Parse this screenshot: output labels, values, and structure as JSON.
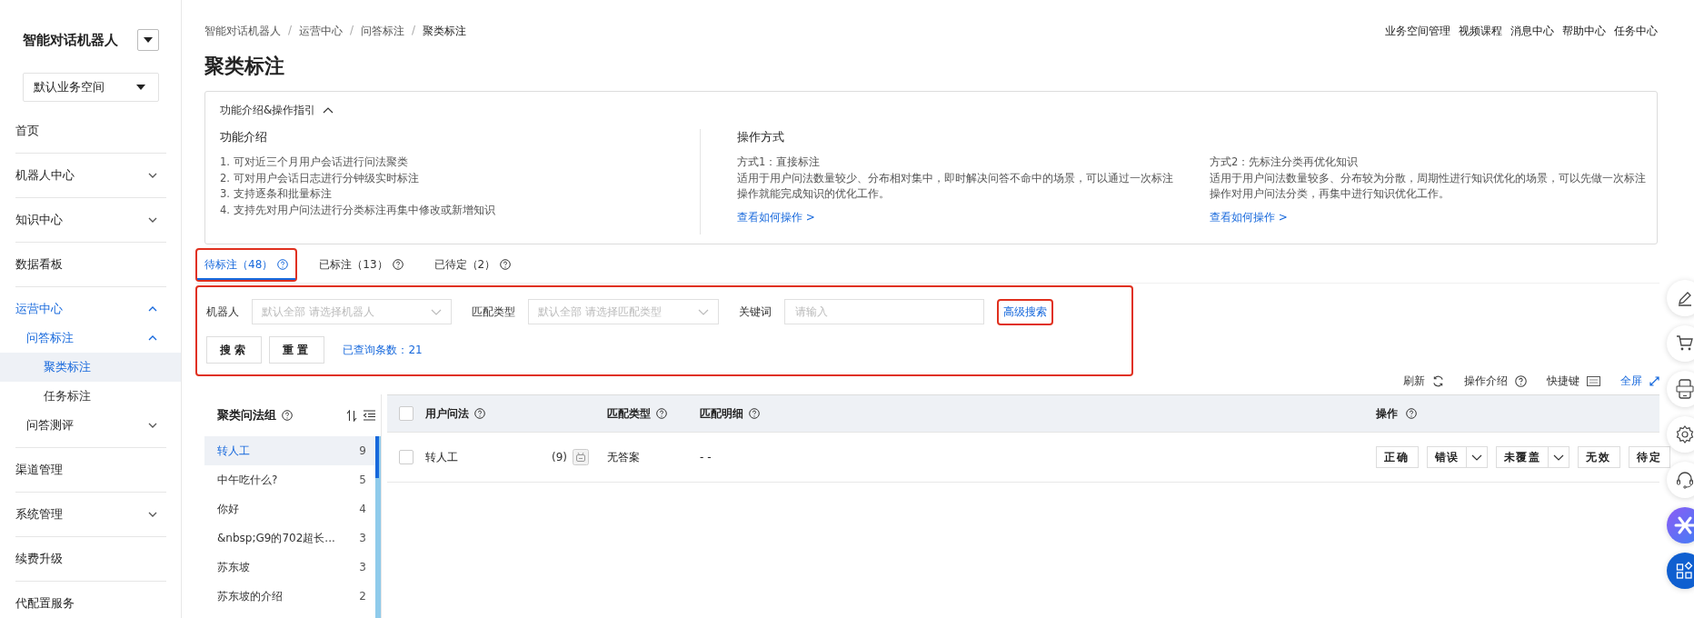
{
  "sidebar": {
    "app_name": "智能对话机器人",
    "workspace": "默认业务空间",
    "items": [
      {
        "label": "首页",
        "selected": false
      },
      {
        "label": "机器人中心",
        "selected": false,
        "expanded": false
      },
      {
        "label": "知识中心",
        "selected": false,
        "expanded": false
      },
      {
        "label": "数据看板",
        "selected": false
      },
      {
        "label": "运营中心",
        "selected": false,
        "expanded": true,
        "children": [
          {
            "label": "问答标注",
            "selected": false,
            "expanded": true,
            "children": [
              {
                "label": "聚类标注",
                "selected": true
              },
              {
                "label": "任务标注",
                "selected": false
              }
            ]
          },
          {
            "label": "问答测评",
            "selected": false,
            "expanded": false
          }
        ]
      },
      {
        "label": "渠道管理",
        "selected": false
      },
      {
        "label": "系统管理",
        "selected": false,
        "expanded": false
      },
      {
        "label": "续费升级",
        "selected": false
      },
      {
        "label": "代配置服务",
        "selected": false
      }
    ]
  },
  "breadcrumb": [
    "智能对话机器人",
    "运营中心",
    "问答标注",
    "聚类标注"
  ],
  "breadcrumb_separator": "/",
  "top_links": [
    "业务空间管理",
    "视频课程",
    "消息中心",
    "帮助中心",
    "任务中心"
  ],
  "page_title": "聚类标注",
  "intro": {
    "title": "功能介绍&操作指引",
    "expanded": true,
    "features_title": "功能介绍",
    "features": [
      "1. 可对近三个月用户会话进行问法聚类",
      "2. 可对用户会话日志进行分钟级实时标注",
      "3. 支持逐条和批量标注",
      "4. 支持先对用户问法进行分类标注再集中修改或新增知识"
    ],
    "methods_title": "操作方式",
    "methods": [
      {
        "name": "方式1：直接标注",
        "text": "适用于用户问法数量较少、分布相对集中，即时解决问答不命中的场景，可以通过一次标注操作就能完成知识的优化工作。",
        "link": "查看如何操作 >"
      },
      {
        "name": "方式2：先标注分类再优化知识",
        "text": "适用于用户问法数量较多、分布较为分散，周期性进行知识优化的场景，可以先做一次标注操作对用户问法分类，再集中进行知识优化工作。",
        "link": "查看如何操作 >"
      }
    ]
  },
  "tabs": [
    {
      "label": "待标注（48）",
      "selected": true,
      "highlighted": true
    },
    {
      "label": "已标注（13）",
      "selected": false,
      "highlighted": false
    },
    {
      "label": "已待定（2）",
      "selected": false,
      "highlighted": false
    }
  ],
  "filters": {
    "highlighted": true,
    "robot": {
      "label": "机器人",
      "placeholder": "默认全部 请选择机器人"
    },
    "match_type": {
      "label": "匹配类型",
      "placeholder": "默认全部 请选择匹配类型"
    },
    "keyword": {
      "label": "关键词",
      "placeholder": "请输入"
    },
    "advanced": {
      "label": "高级搜索",
      "highlighted": true
    },
    "buttons": [
      "搜索",
      "重置"
    ],
    "result_count": "已查询条数：21"
  },
  "toolbar": [
    {
      "label": "刷新",
      "kind": "action"
    },
    {
      "label": "操作介绍",
      "kind": "action"
    },
    {
      "label": "快捷键",
      "kind": "action"
    },
    {
      "label": "全屏",
      "kind": "link"
    }
  ],
  "groups": {
    "title": "聚类问法组",
    "items": [
      {
        "label": "转人工",
        "count": "9",
        "selected": true
      },
      {
        "label": "中午吃什么?",
        "count": "5",
        "selected": false
      },
      {
        "label": "你好",
        "count": "4",
        "selected": false
      },
      {
        "label": "&nbsp;G9的702超长...",
        "count": "3",
        "selected": false
      },
      {
        "label": "苏东坡",
        "count": "3",
        "selected": false
      },
      {
        "label": "苏东坡的介绍",
        "count": "2",
        "selected": false
      }
    ]
  },
  "table": {
    "select_all": {
      "checked": false
    },
    "columns": [
      "用户问法",
      "匹配类型",
      "匹配明细",
      "操作"
    ],
    "rows": [
      {
        "checked": false,
        "question": "转人工",
        "count": "(9)",
        "match_type": "无答案",
        "detail": "- -",
        "actions": [
          {
            "label": "正确",
            "dropdown": false
          },
          {
            "label": "错误",
            "dropdown": true
          },
          {
            "label": "未覆盖",
            "dropdown": true
          },
          {
            "label": "无效",
            "dropdown": false
          },
          {
            "label": "待定",
            "dropdown": false
          }
        ]
      }
    ]
  }
}
